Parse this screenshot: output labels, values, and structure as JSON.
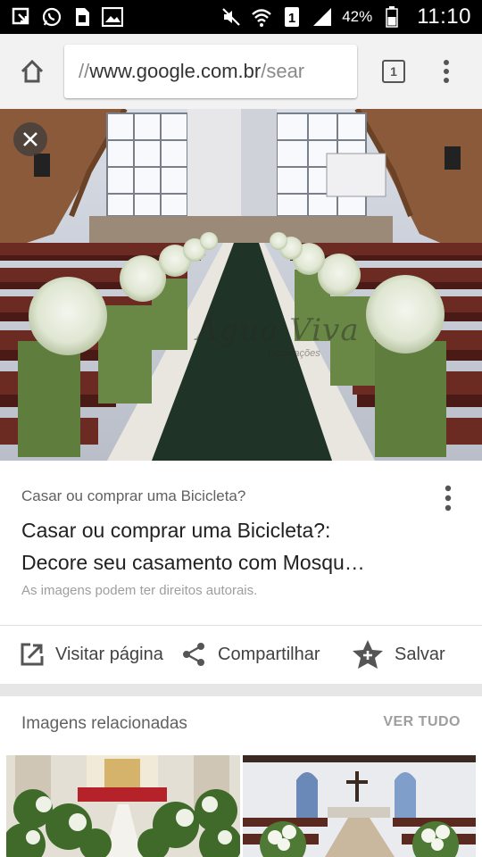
{
  "status_bar": {
    "left_icons": [
      "download-notification-icon",
      "whatsapp-icon",
      "sim-card-icon",
      "image-notification-icon"
    ],
    "right_icons": [
      "mute-icon",
      "wifi-icon",
      "sim-1-icon",
      "signal-icon",
      "battery-icon"
    ],
    "battery_percent": "42%",
    "time": "11:10"
  },
  "browser": {
    "url_scheme": "//",
    "url_host": "www.google.com.br",
    "url_path": "/sear",
    "tab_count": "1"
  },
  "image": {
    "watermark_main": "Água Viva",
    "watermark_sub": "Decorações"
  },
  "result": {
    "source": "Casar ou comprar uma Bicicleta?",
    "title_line1": "Casar ou comprar uma Bicicleta?:",
    "title_line2": "Decore seu casamento com Mosqu…",
    "copyright_note": "As imagens podem ter direitos autorais."
  },
  "actions": {
    "visit_label": "Visitar página",
    "share_label": "Compartilhar",
    "save_label": "Salvar"
  },
  "related": {
    "title": "Imagens relacionadas",
    "see_all": "VER TUDO"
  },
  "colors": {
    "toolbar_bg": "#f2f2f2",
    "status_bar_bg": "#000000",
    "text_primary": "#212121",
    "text_secondary": "#616161",
    "text_hint": "#9e9e9e",
    "icon_color": "#555555"
  }
}
